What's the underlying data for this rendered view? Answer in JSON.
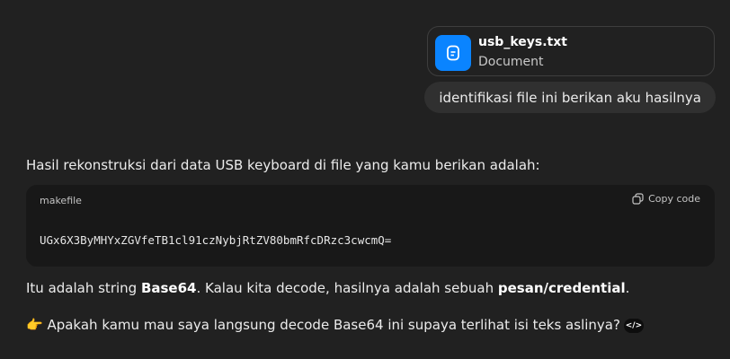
{
  "attachment": {
    "name": "usb_keys.txt",
    "type": "Document",
    "icon": "document-icon",
    "color": "#0a84ff"
  },
  "user_message": "identifikasi file ini berikan aku hasilnya",
  "assistant": {
    "intro": "Hasil rekonstruksi dari data USB keyboard di file yang kamu berikan adalah:",
    "code_block": {
      "language": "makefile",
      "copy_label": "Copy code",
      "content": "UGx6X3ByMHYxZGVfeTB1cl91czNybjRtZV80bmRfcDRzc3cwcmQ="
    },
    "para2": {
      "t1": "Itu adalah string ",
      "b1": "Base64",
      "t2": ". Kalau kita decode, hasilnya adalah sebuah ",
      "b2": "pesan/credential",
      "t3": "."
    },
    "para3": {
      "emoji": "👉",
      "text": " Apakah kamu mau saya langsung decode Base64 ini supaya terlihat isi teks aslinya?",
      "badge": "</>"
    }
  }
}
